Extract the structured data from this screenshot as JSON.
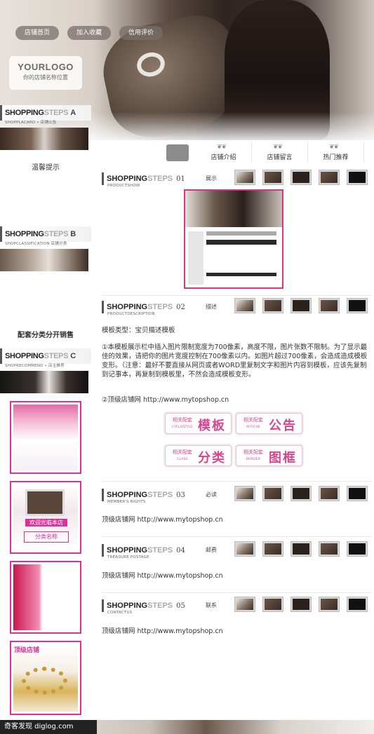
{
  "top_nav": [
    {
      "label": "店铺首页"
    },
    {
      "label": "加入收藏"
    },
    {
      "label": "信用评价"
    }
  ],
  "logo": {
    "title": "YOURLOGO",
    "subtitle": "你的店铺名称位置"
  },
  "tabs": [
    {
      "label": "店铺介绍"
    },
    {
      "label": "店铺留言"
    },
    {
      "label": "热门推荐"
    }
  ],
  "sidebar": {
    "box_a": {
      "title_a": "SHOPPING",
      "title_b": "STEPS",
      "letter": "A",
      "subtitle": "SHOPPLACARD • 店铺公告"
    },
    "notice_text": "温馨提示",
    "box_b": {
      "title_a": "SHOPPING",
      "title_b": "STEPS",
      "letter": "B",
      "subtitle": "SHOPCLASSIFICATION 店铺分类"
    },
    "sale_text": "配套分类分开销售",
    "box_c": {
      "title_a": "SHOPPING",
      "title_b": "STEPS",
      "letter": "C",
      "subtitle": "SHOPRECOMMEND • 店主推荐"
    },
    "thumb2_caption": "欢迎光临本店",
    "thumb2_caption2": "分类名称",
    "thumb4_tag": "顶级店铺"
  },
  "sections": [
    {
      "num": "01",
      "sub": "PRODUCTSHOW",
      "label": "展示"
    },
    {
      "num": "02",
      "sub": "PRODUCTDESCRIPTION",
      "label": "描述"
    },
    {
      "num": "03",
      "sub": "MEMBER'S RIGHTS",
      "label": "必读"
    },
    {
      "num": "04",
      "sub": "TREASURE POSTAGE",
      "label": "邮费"
    },
    {
      "num": "05",
      "sub": "CONTACTUS",
      "label": "联系"
    }
  ],
  "shopping": {
    "a": "SHOPPING",
    "b": "STEPS"
  },
  "description": {
    "type_line": "模板类型：宝贝描述模板",
    "para": "①本模板展示栏中插入图片限制宽度为700像素，高度不限，图片张数不限制。为了显示最佳的效果，请把你的图片宽度控制在700像素以内。如图片超过700像素，会造成造成模板变形。（注意：最好不要直接从网页或者WORD里复制文字和图片内容到模板，应该先复制到记事本，再复制到模板里，不然会造成模板变形。",
    "link_line": "②顶级店铺网  http://www.mytopshop.cn"
  },
  "cat_buttons": [
    {
      "small": "相关配套",
      "en": "CYCLOSTYLE",
      "big": "模板"
    },
    {
      "small": "相关配套",
      "en": "AFFICHE",
      "big": "公告"
    },
    {
      "small": "相关配套",
      "en": "CLASS",
      "big": "分类"
    },
    {
      "small": "相关配套",
      "en": "BORDER",
      "big": "图框"
    }
  ],
  "site_line": "顶级店铺网  http://www.mytopshop.cn",
  "watermark": "奇客发现 diglog.com",
  "colors": {
    "accent_pink": "#d6339a",
    "frame_pink": "#c93b8d"
  }
}
